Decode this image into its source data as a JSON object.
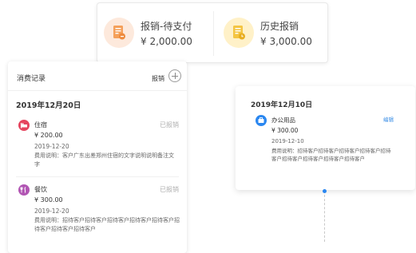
{
  "summary": {
    "pending": {
      "title": "报销-待支付",
      "amount": "¥ 2,000.00",
      "icon": "document-stamp-icon",
      "color": "#f5a05a"
    },
    "history": {
      "title": "历史报销",
      "amount": "¥ 3,000.00",
      "icon": "document-clock-icon",
      "color": "#f4c542"
    }
  },
  "records_panel": {
    "title": "消费记录",
    "reimburse_label": "报销",
    "date": "2019年12月20日",
    "items": [
      {
        "name": "住宿",
        "status": "已报销",
        "amount": "¥ 200.00",
        "date": "2019-12-20",
        "desc": "费用说明：客户广东出差郑州住宿的文字说明说明备注文字",
        "icon": "hotel-icon",
        "color": "#e5455f"
      },
      {
        "name": "餐饮",
        "status": "已报销",
        "amount": "¥ 300.00",
        "date": "2019-12-20",
        "desc": "费用说明：招待客户招待客户招待客户招待客户招待客户招待客户招待客户招待客户",
        "icon": "dining-icon",
        "color": "#b155b3"
      }
    ]
  },
  "detail_card": {
    "date": "2019年12月10日",
    "item": {
      "name": "办公用品",
      "action": "编辑",
      "amount": "¥ 300.00",
      "date": "2019-12-10",
      "desc": "费用说明：招待客户招待客户招待客户招待客户招待客户招待客户招待客户招待客户招待客户",
      "icon": "office-supplies-icon",
      "color": "#2b87f0"
    }
  }
}
